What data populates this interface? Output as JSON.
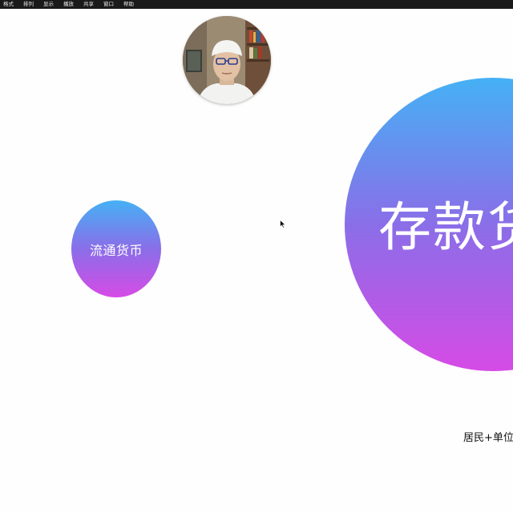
{
  "menubar": {
    "items": [
      "格式",
      "排列",
      "显示",
      "播放",
      "共享",
      "窗口",
      "帮助"
    ]
  },
  "slide": {
    "bubble_small_label": "流通货币",
    "bubble_large_label": "存款货",
    "caption": "居民+单位"
  },
  "colors": {
    "gradient_top": "#45b1f5",
    "gradient_mid": "#8a6ee8",
    "gradient_bottom": "#d64be6",
    "menubar_bg": "#1a1a1a",
    "background": "#fefefe"
  },
  "icons": {
    "cursor": "arrow-cursor-icon"
  }
}
